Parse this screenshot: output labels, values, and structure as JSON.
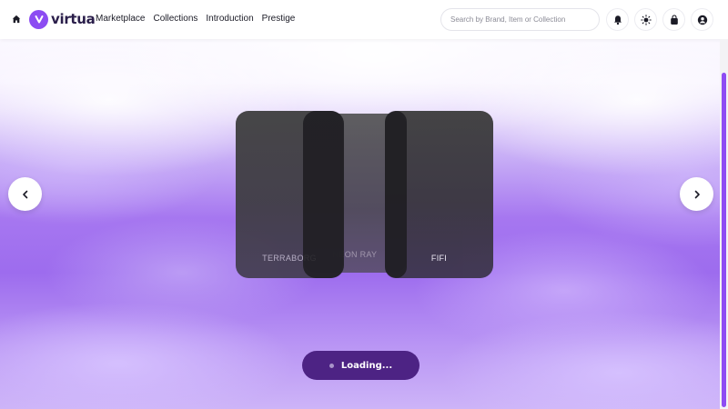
{
  "brand": {
    "name": "virtua",
    "accent": "#8c4cf2"
  },
  "header": {
    "home_icon": "home-icon",
    "nav": [
      "Marketplace",
      "Collections",
      "Introduction",
      "Prestige"
    ],
    "search": {
      "placeholder": "Search by Brand, Item or Collection",
      "value": ""
    },
    "icons": [
      "bell-icon",
      "sun-icon",
      "bag-icon",
      "user-icon"
    ]
  },
  "carousel": {
    "prev_icon": "chevron-left-icon",
    "next_icon": "chevron-right-icon",
    "cards": [
      "TERRABORG",
      "NEON RAY",
      "FIFI"
    ]
  },
  "status": {
    "loading_text": "Loading..."
  }
}
